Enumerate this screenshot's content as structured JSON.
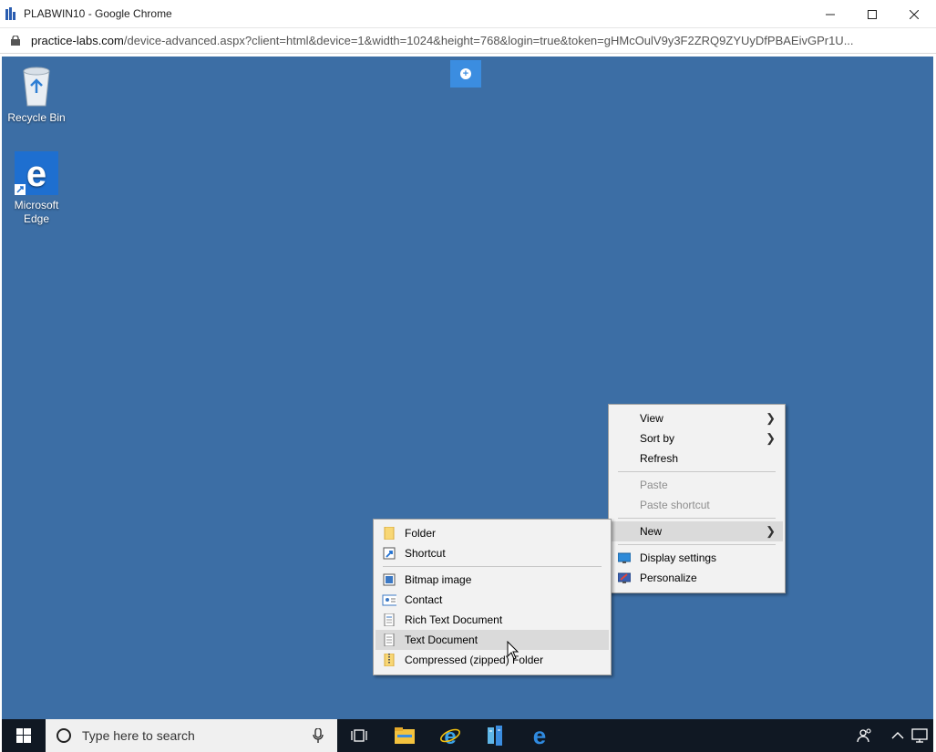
{
  "window": {
    "title": "PLABWIN10 - Google Chrome",
    "controls": {
      "minimize": "—",
      "maximize": "☐",
      "close": "✕"
    }
  },
  "address_bar": {
    "host": "practice-labs.com",
    "path": "/device-advanced.aspx?client=html&device=1&width=1024&height=768&login=true&token=gHMcOulV9y3F2ZRQ9ZYUyDfPBAEivGPr1U..."
  },
  "desktop": {
    "background_color": "#3c6ea5",
    "icons": [
      {
        "label": "Recycle Bin",
        "icon": "recycle-bin-icon"
      },
      {
        "label": "Microsoft Edge",
        "icon": "edge-icon"
      }
    ]
  },
  "context_menu": {
    "items": [
      {
        "label": "View",
        "submenu": true
      },
      {
        "label": "Sort by",
        "submenu": true
      },
      {
        "label": "Refresh"
      },
      {
        "label": "Paste",
        "disabled": true
      },
      {
        "label": "Paste shortcut",
        "disabled": true
      },
      {
        "label": "New",
        "submenu": true,
        "highlighted": true
      },
      {
        "label": "Display settings",
        "icon": "display-icon"
      },
      {
        "label": "Personalize",
        "icon": "personalize-icon"
      }
    ]
  },
  "new_submenu": {
    "items": [
      {
        "label": "Folder",
        "icon": "folder-icon"
      },
      {
        "label": "Shortcut",
        "icon": "shortcut-icon"
      },
      {
        "label": "Bitmap image",
        "icon": "bitmap-icon"
      },
      {
        "label": "Contact",
        "icon": "contact-icon"
      },
      {
        "label": "Rich Text Document",
        "icon": "rich-text-icon"
      },
      {
        "label": "Text Document",
        "icon": "text-document-icon",
        "highlighted": true
      },
      {
        "label": "Compressed (zipped) Folder",
        "icon": "zip-folder-icon"
      }
    ]
  },
  "taskbar": {
    "search_placeholder": "Type here to search",
    "pinned": [
      "task-view-icon",
      "file-explorer-icon",
      "internet-explorer-icon",
      "server-manager-icon",
      "edge-icon"
    ],
    "tray": [
      "people-icon",
      "chevron-up-icon",
      "notifications-icon"
    ]
  }
}
